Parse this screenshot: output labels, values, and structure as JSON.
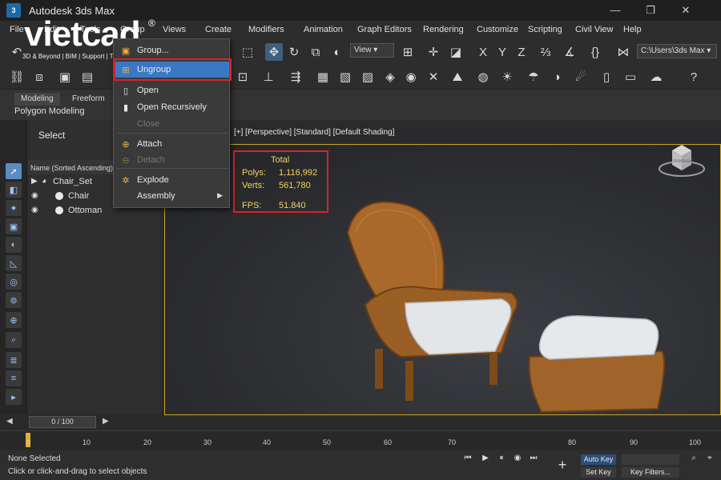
{
  "window": {
    "title": "Autodesk 3ds Max",
    "app_icon": "3",
    "controls": [
      "—",
      "❐",
      "✕"
    ]
  },
  "watermark": {
    "brand": "vietcad",
    "registered": "®",
    "tagline": "3D & Beyond | BIM | Support | Training"
  },
  "menubar": [
    "File",
    "Edit",
    "Tools",
    "Group",
    "Views",
    "Create",
    "Modifiers",
    "Animation",
    "Graph Editors",
    "Rendering",
    "Customize",
    "Scripting",
    "Civil View",
    "Help"
  ],
  "toolbar": {
    "view_dropdown": "View",
    "coords": [
      "X",
      "Y",
      "Z"
    ],
    "path_dropdown": "C:\\Users\\3ds Max"
  },
  "ribbon": {
    "tabs": [
      "Modeling",
      "Freeform"
    ],
    "subtitle": "Polygon Modeling"
  },
  "context_menu": {
    "items": [
      {
        "label": "Group...",
        "icon": "group-icon",
        "enabled": true
      },
      {
        "label": "Ungroup",
        "icon": "ungroup-icon",
        "enabled": true,
        "highlighted": true
      },
      {
        "label": "Open",
        "icon": "open-icon",
        "enabled": true
      },
      {
        "label": "Open Recursively",
        "icon": "open-recursive-icon",
        "enabled": true
      },
      {
        "label": "Close",
        "icon": "",
        "enabled": false
      },
      {
        "label": "Attach",
        "icon": "attach-icon",
        "enabled": true
      },
      {
        "label": "Detach",
        "icon": "detach-icon",
        "enabled": false
      },
      {
        "label": "Explode",
        "icon": "explode-icon",
        "enabled": true
      },
      {
        "label": "Assembly",
        "icon": "",
        "enabled": true,
        "submenu": true
      }
    ]
  },
  "explorer": {
    "title": "Select",
    "column": "Name (Sorted Ascending)",
    "items": [
      {
        "name": "Chair_Set",
        "type": "group"
      },
      {
        "name": "Chair",
        "type": "object"
      },
      {
        "name": "Ottoman",
        "type": "object"
      }
    ]
  },
  "viewport": {
    "label": "[+] [Perspective] [Standard] [Default Shading]",
    "stats": {
      "header": "Total",
      "polys_label": "Polys:",
      "polys": "1,116,992",
      "verts_label": "Verts:",
      "verts": "561,780",
      "fps_label": "FPS:",
      "fps": "51.840"
    },
    "viewcube": {
      "front": "FRONT",
      "right": "RIGHT"
    }
  },
  "timeline": {
    "slider": "0 / 100",
    "ticks": [
      "0",
      "10",
      "20",
      "30",
      "40",
      "50",
      "60",
      "70",
      "80",
      "90",
      "100"
    ]
  },
  "status": {
    "selection": "None Selected",
    "hint": "Click or click-and-drag to select objects",
    "auto_key": "Auto Key",
    "set_key": "Set Key",
    "key_filters": "Key Filters..."
  },
  "colors": {
    "accent": "#3b78c4",
    "highlight_outline": "#d6232a",
    "stats_text": "#f4d35e",
    "viewport_border": "#c9a52c"
  }
}
